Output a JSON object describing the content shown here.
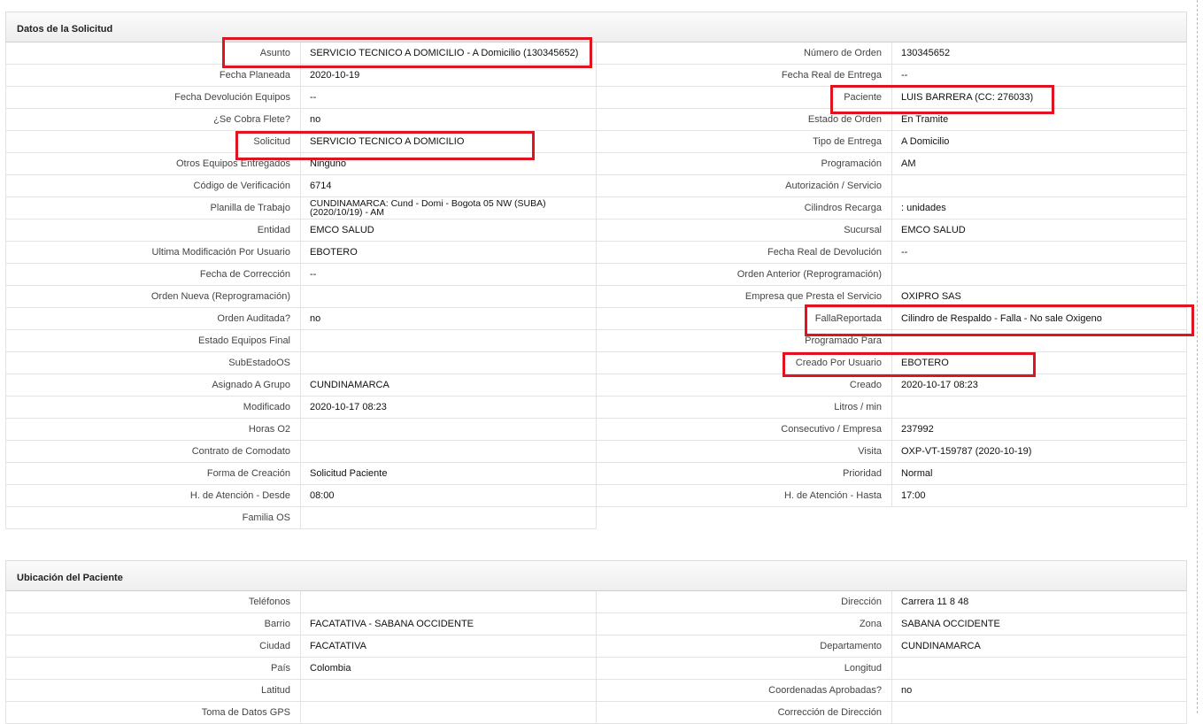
{
  "solicitud": {
    "title": "Datos de la Solicitud",
    "rows": [
      [
        {
          "l": "Asunto",
          "v": "SERVICIO TECNICO A DOMICILIO - A Domicilio (130345652)"
        },
        {
          "l": "Número de Orden",
          "v": "130345652"
        }
      ],
      [
        {
          "l": "Fecha Planeada",
          "v": "2020-10-19"
        },
        {
          "l": "Fecha Real de Entrega",
          "v": "--"
        }
      ],
      [
        {
          "l": "Fecha Devolución Equipos",
          "v": "--"
        },
        {
          "l": "Paciente",
          "v": "LUIS BARRERA (CC: 276033)"
        }
      ],
      [
        {
          "l": "¿Se Cobra Flete?",
          "v": "no"
        },
        {
          "l": "Estado de Orden",
          "v": "En Tramite"
        }
      ],
      [
        {
          "l": "Solicitud",
          "v": "SERVICIO TECNICO A DOMICILIO"
        },
        {
          "l": "Tipo de Entrega",
          "v": "A Domicilio"
        }
      ],
      [
        {
          "l": "Otros Equipos Entregados",
          "v": "Ninguno"
        },
        {
          "l": "Programación",
          "v": "AM"
        }
      ],
      [
        {
          "l": "Código de Verificación",
          "v": "6714"
        },
        {
          "l": "Autorización / Servicio",
          "v": ""
        }
      ],
      [
        {
          "l": "Planilla de Trabajo",
          "v": "CUNDINAMARCA: Cund - Domi - Bogota 05 NW (SUBA) (2020/10/19) - AM"
        },
        {
          "l": "Cilindros Recarga",
          "v": ": unidades"
        }
      ],
      [
        {
          "l": "Entidad",
          "v": "EMCO SALUD"
        },
        {
          "l": "Sucursal",
          "v": "EMCO SALUD"
        }
      ],
      [
        {
          "l": "Ultima Modificación Por Usuario",
          "v": "EBOTERO"
        },
        {
          "l": "Fecha Real de Devolución",
          "v": "--"
        }
      ],
      [
        {
          "l": "Fecha de Corrección",
          "v": "--"
        },
        {
          "l": "Orden Anterior (Reprogramación)",
          "v": ""
        }
      ],
      [
        {
          "l": "Orden Nueva (Reprogramación)",
          "v": ""
        },
        {
          "l": "Empresa que Presta el Servicio",
          "v": "OXIPRO SAS"
        }
      ],
      [
        {
          "l": "Orden Auditada?",
          "v": "no"
        },
        {
          "l": "FallaReportada",
          "v": "Cilindro de Respaldo - Falla - No sale Oxigeno"
        }
      ],
      [
        {
          "l": "Estado Equipos Final",
          "v": ""
        },
        {
          "l": "Programado Para",
          "v": ""
        }
      ],
      [
        {
          "l": "SubEstadoOS",
          "v": ""
        },
        {
          "l": "Creado Por Usuario",
          "v": "EBOTERO"
        }
      ],
      [
        {
          "l": "Asignado A Grupo",
          "v": "CUNDINAMARCA"
        },
        {
          "l": "Creado",
          "v": "2020-10-17 08:23"
        }
      ],
      [
        {
          "l": "Modificado",
          "v": "2020-10-17 08:23"
        },
        {
          "l": "Litros / min",
          "v": ""
        }
      ],
      [
        {
          "l": "Horas O2",
          "v": ""
        },
        {
          "l": "Consecutivo / Empresa",
          "v": "237992"
        }
      ],
      [
        {
          "l": "Contrato de Comodato",
          "v": ""
        },
        {
          "l": "Visita",
          "v": "OXP-VT-159787 (2020-10-19)"
        }
      ],
      [
        {
          "l": "Forma de Creación",
          "v": "Solicitud Paciente"
        },
        {
          "l": "Prioridad",
          "v": "Normal"
        }
      ],
      [
        {
          "l": "H. de Atención - Desde",
          "v": "08:00"
        },
        {
          "l": "H. de Atención - Hasta",
          "v": "17:00"
        }
      ],
      [
        {
          "l": "Familia OS",
          "v": ""
        }
      ]
    ]
  },
  "ubicacion": {
    "title": "Ubicación del Paciente",
    "rows": [
      [
        {
          "l": "Teléfonos",
          "v": ""
        },
        {
          "l": "Dirección",
          "v": "Carrera 11 8 48"
        }
      ],
      [
        {
          "l": "Barrio",
          "v": "FACATATIVA - SABANA OCCIDENTE"
        },
        {
          "l": "Zona",
          "v": "SABANA OCCIDENTE"
        }
      ],
      [
        {
          "l": "Ciudad",
          "v": "FACATATIVA"
        },
        {
          "l": "Departamento",
          "v": "CUNDINAMARCA"
        }
      ],
      [
        {
          "l": "País",
          "v": "Colombia"
        },
        {
          "l": "Longitud",
          "v": ""
        }
      ],
      [
        {
          "l": "Latitud",
          "v": ""
        },
        {
          "l": "Coordenadas Aprobadas?",
          "v": "no"
        }
      ],
      [
        {
          "l": "Toma de Datos GPS",
          "v": ""
        },
        {
          "l": "Corrección de Dirección",
          "v": ""
        }
      ]
    ]
  },
  "highlight_color": "#e0141e"
}
